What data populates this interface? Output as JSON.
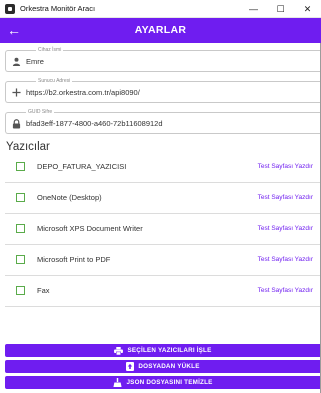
{
  "window": {
    "title": "Orkestra Monitör Aracı",
    "minimize": "—",
    "maximize": "☐",
    "close": "✕"
  },
  "appbar": {
    "title": "AYARLAR",
    "back": "←"
  },
  "fields": {
    "device_name": {
      "label": "Cihaz İsmi",
      "value": "Emre",
      "icon": "person-icon"
    },
    "server_address": {
      "label": "Sunucu Adresi",
      "value": "https://b2.orkestra.com.tr/api8090/",
      "icon": "plus-icon"
    },
    "guid": {
      "label": "GUID Sifre",
      "value": "bfad3eff-1877-4800-a460-72b11608912d",
      "icon": "lock-icon"
    }
  },
  "printers": {
    "title": "Yazıcılar",
    "test_label": "Test Sayfası Yazdır",
    "items": [
      {
        "name": "DEPO_FATURA_YAZICISI",
        "checked": false
      },
      {
        "name": "OneNote (Desktop)",
        "checked": false
      },
      {
        "name": "Microsoft XPS Document Writer",
        "checked": false
      },
      {
        "name": "Microsoft Print to PDF",
        "checked": false
      },
      {
        "name": "Fax",
        "checked": false
      }
    ]
  },
  "actions": {
    "process_selected": "SEÇİLEN YAZICILARI İŞLE",
    "load_from_file": "DOSYADAN YÜKLE",
    "clear_json": "JSON DOSYASINI TEMİZLE"
  },
  "colors": {
    "accent": "#6f1df0",
    "checkbox": "#5aab4a"
  }
}
